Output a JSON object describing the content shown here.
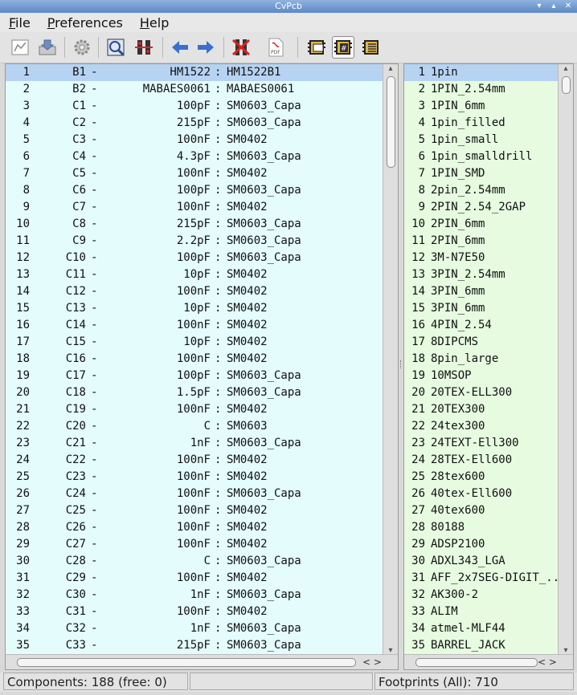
{
  "window": {
    "title": "CvPcb"
  },
  "menu": [
    {
      "label": "File",
      "accel": "F",
      "rest": "ile"
    },
    {
      "label": "Preferences",
      "accel": "P",
      "rest": "references"
    },
    {
      "label": "Help",
      "accel": "H",
      "rest": "elp"
    }
  ],
  "toolbar": {
    "buttons": [
      {
        "name": "footprint-viewer-button",
        "icon": "footprint-viewer-icon"
      },
      {
        "name": "save-button",
        "icon": "save-icon"
      },
      {
        "name": "config-button",
        "icon": "gear-icon"
      },
      {
        "name": "module-filter-button",
        "icon": "module-filter-icon"
      },
      {
        "name": "auto-associate-button",
        "icon": "auto-associate-icon"
      },
      {
        "name": "previous-button",
        "icon": "arrow-left-icon"
      },
      {
        "name": "next-button",
        "icon": "arrow-right-icon"
      },
      {
        "name": "delete-associations-button",
        "icon": "delete-icon"
      },
      {
        "name": "pdf-doc-button",
        "icon": "pdf-icon"
      },
      {
        "name": "filter-keyword-button",
        "icon": "filter-keyword-icon"
      },
      {
        "name": "filter-pincount-button",
        "icon": "filter-pincount-icon"
      },
      {
        "name": "filter-none-button",
        "icon": "filter-none-icon"
      }
    ]
  },
  "components": [
    {
      "num": "1",
      "ref": "B1",
      "value": "HM1522",
      "footprint": "HM1522B1"
    },
    {
      "num": "2",
      "ref": "B2",
      "value": "MABAES0061",
      "footprint": "MABAES0061"
    },
    {
      "num": "3",
      "ref": "C1",
      "value": "100pF",
      "footprint": "SM0603_Capa"
    },
    {
      "num": "4",
      "ref": "C2",
      "value": "215pF",
      "footprint": "SM0603_Capa"
    },
    {
      "num": "5",
      "ref": "C3",
      "value": "100nF",
      "footprint": "SM0402"
    },
    {
      "num": "6",
      "ref": "C4",
      "value": "4.3pF",
      "footprint": "SM0603_Capa"
    },
    {
      "num": "7",
      "ref": "C5",
      "value": "100nF",
      "footprint": "SM0402"
    },
    {
      "num": "8",
      "ref": "C6",
      "value": "100pF",
      "footprint": "SM0603_Capa"
    },
    {
      "num": "9",
      "ref": "C7",
      "value": "100nF",
      "footprint": "SM0402"
    },
    {
      "num": "10",
      "ref": "C8",
      "value": "215pF",
      "footprint": "SM0603_Capa"
    },
    {
      "num": "11",
      "ref": "C9",
      "value": "2.2pF",
      "footprint": "SM0603_Capa"
    },
    {
      "num": "12",
      "ref": "C10",
      "value": "100pF",
      "footprint": "SM0603_Capa"
    },
    {
      "num": "13",
      "ref": "C11",
      "value": "10pF",
      "footprint": "SM0402"
    },
    {
      "num": "14",
      "ref": "C12",
      "value": "100nF",
      "footprint": "SM0402"
    },
    {
      "num": "15",
      "ref": "C13",
      "value": "10pF",
      "footprint": "SM0402"
    },
    {
      "num": "16",
      "ref": "C14",
      "value": "100nF",
      "footprint": "SM0402"
    },
    {
      "num": "17",
      "ref": "C15",
      "value": "10pF",
      "footprint": "SM0402"
    },
    {
      "num": "18",
      "ref": "C16",
      "value": "100nF",
      "footprint": "SM0402"
    },
    {
      "num": "19",
      "ref": "C17",
      "value": "100pF",
      "footprint": "SM0603_Capa"
    },
    {
      "num": "20",
      "ref": "C18",
      "value": "1.5pF",
      "footprint": "SM0603_Capa"
    },
    {
      "num": "21",
      "ref": "C19",
      "value": "100nF",
      "footprint": "SM0402"
    },
    {
      "num": "22",
      "ref": "C20",
      "value": "C",
      "footprint": "SM0603"
    },
    {
      "num": "23",
      "ref": "C21",
      "value": "1nF",
      "footprint": "SM0603_Capa"
    },
    {
      "num": "24",
      "ref": "C22",
      "value": "100nF",
      "footprint": "SM0402"
    },
    {
      "num": "25",
      "ref": "C23",
      "value": "100nF",
      "footprint": "SM0402"
    },
    {
      "num": "26",
      "ref": "C24",
      "value": "100nF",
      "footprint": "SM0603_Capa"
    },
    {
      "num": "27",
      "ref": "C25",
      "value": "100nF",
      "footprint": "SM0402"
    },
    {
      "num": "28",
      "ref": "C26",
      "value": "100nF",
      "footprint": "SM0402"
    },
    {
      "num": "29",
      "ref": "C27",
      "value": "100nF",
      "footprint": "SM0402"
    },
    {
      "num": "30",
      "ref": "C28",
      "value": "C",
      "footprint": "SM0603_Capa"
    },
    {
      "num": "31",
      "ref": "C29",
      "value": "100nF",
      "footprint": "SM0402"
    },
    {
      "num": "32",
      "ref": "C30",
      "value": "1nF",
      "footprint": "SM0603_Capa"
    },
    {
      "num": "33",
      "ref": "C31",
      "value": "100nF",
      "footprint": "SM0402"
    },
    {
      "num": "34",
      "ref": "C32",
      "value": "1nF",
      "footprint": "SM0603_Capa"
    },
    {
      "num": "35",
      "ref": "C33",
      "value": "215pF",
      "footprint": "SM0603_Capa"
    }
  ],
  "footprints": [
    {
      "num": "1",
      "name": "1pin"
    },
    {
      "num": "2",
      "name": "1PIN_2.54mm"
    },
    {
      "num": "3",
      "name": "1PIN_6mm"
    },
    {
      "num": "4",
      "name": "1pin_filled"
    },
    {
      "num": "5",
      "name": "1pin_small"
    },
    {
      "num": "6",
      "name": "1pin_smalldrill"
    },
    {
      "num": "7",
      "name": "1PIN_SMD"
    },
    {
      "num": "8",
      "name": "2pin_2.54mm"
    },
    {
      "num": "9",
      "name": "2PIN_2.54_2GAP"
    },
    {
      "num": "10",
      "name": "2PIN_6mm"
    },
    {
      "num": "11",
      "name": "2PIN_6mm"
    },
    {
      "num": "12",
      "name": "3M-N7E50"
    },
    {
      "num": "13",
      "name": "3PIN_2.54mm"
    },
    {
      "num": "14",
      "name": "3PIN_6mm"
    },
    {
      "num": "15",
      "name": "3PIN_6mm"
    },
    {
      "num": "16",
      "name": "4PIN_2.54"
    },
    {
      "num": "17",
      "name": "8DIPCMS"
    },
    {
      "num": "18",
      "name": "8pin_large"
    },
    {
      "num": "19",
      "name": "10MSOP"
    },
    {
      "num": "20",
      "name": "20TEX-ELL300"
    },
    {
      "num": "21",
      "name": "20TEX300"
    },
    {
      "num": "22",
      "name": "24tex300"
    },
    {
      "num": "23",
      "name": "24TEXT-Ell300"
    },
    {
      "num": "24",
      "name": "28TEX-Ell600"
    },
    {
      "num": "25",
      "name": "28tex600"
    },
    {
      "num": "26",
      "name": "40tex-Ell600"
    },
    {
      "num": "27",
      "name": "40tex600"
    },
    {
      "num": "28",
      "name": "80188"
    },
    {
      "num": "29",
      "name": "ADSP2100"
    },
    {
      "num": "30",
      "name": "ADXL343_LGA"
    },
    {
      "num": "31",
      "name": "AFF_2x7SEG-DIGIT_..."
    },
    {
      "num": "32",
      "name": "AK300-2"
    },
    {
      "num": "33",
      "name": "ALIM"
    },
    {
      "num": "34",
      "name": "atmel-MLF44"
    },
    {
      "num": "35",
      "name": "BARREL_JACK"
    }
  ],
  "status": {
    "components": "Components: 188 (free: 0)",
    "middle": "",
    "footprints": "Footprints (All): 710"
  },
  "colors": {
    "component_row_bg": "#e4fcfc",
    "footprint_row_bg": "#e6fbe0",
    "selected_bg": "#b7d3f3",
    "arrow_blue": "#3a6fd1"
  }
}
